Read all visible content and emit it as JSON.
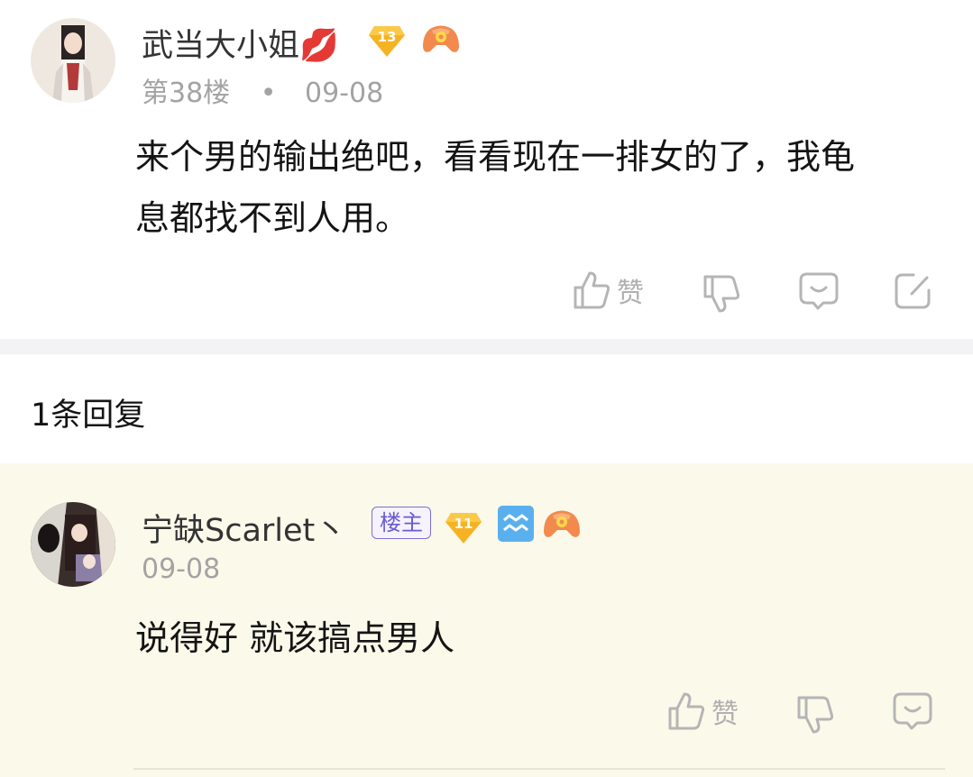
{
  "post": {
    "author": "武当大小姐",
    "author_emoji": "💋",
    "level": "13",
    "floor": "第38楼",
    "separator": "•",
    "date": "09-08",
    "content_line1": "来个男的输出绝吧，看看现在一排女的了，我龟",
    "content_line2": "息都找不到人用。",
    "like_label": "赞"
  },
  "reply_count": "1条回复",
  "reply": {
    "author": "宁缺Scarlet丶",
    "tag": "楼主",
    "level": "11",
    "date": "09-08",
    "content": "说得好 就该搞点男人",
    "like_label": "赞"
  },
  "colors": {
    "level_badge": "#f5b324",
    "game_badge": "#f28a4e",
    "aquarius_badge": "#5ab0ee",
    "reply_bg": "#fbf9ea",
    "lz_tag": "#6a5cd2"
  },
  "icons": [
    "like-icon",
    "dislike-icon",
    "comment-icon",
    "share-icon",
    "level-diamond-icon",
    "gamepad-icon",
    "aquarius-icon"
  ]
}
